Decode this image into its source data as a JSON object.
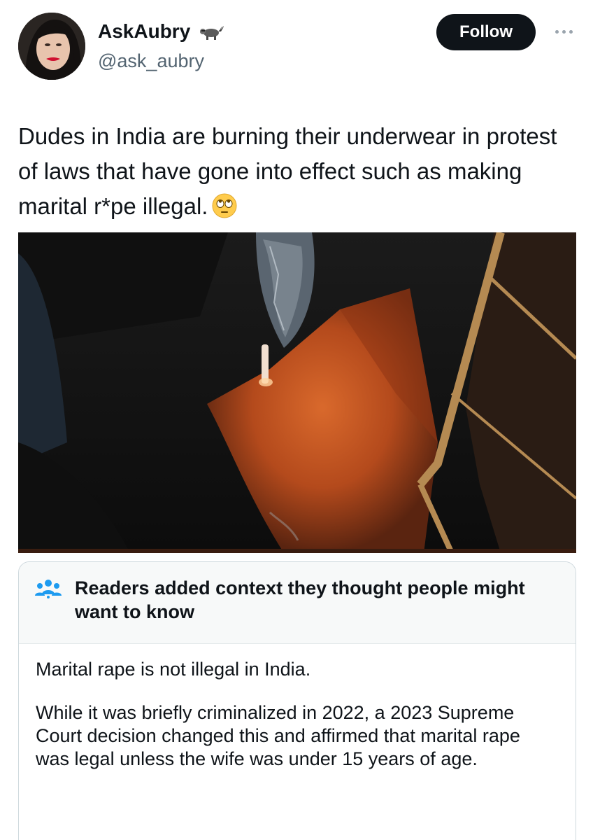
{
  "user": {
    "display_name": "AskAubry",
    "handle": "@ask_aubry",
    "badge_icon": "raccoon-icon",
    "avatar_icon": "avatar-photo"
  },
  "actions": {
    "follow_label": "Follow",
    "more_icon": "more-dots-icon"
  },
  "tweet": {
    "text": "Dudes in India are burning their underwear in protest of laws that have gone into effect such as making marital r*pe illegal.",
    "emoji_icon": "face-with-rolling-eyes-emoji"
  },
  "media": {
    "kind": "video-still",
    "icon": "burning-underwear-photo"
  },
  "community_note": {
    "header_icon": "people-icon",
    "title": "Readers added context they thought people might want to know",
    "paragraphs": [
      "Marital rape is not illegal in India.",
      "While it was briefly criminalized in 2022, a 2023 Supreme Court decision changed this and affirmed that marital rape was legal unless the wife was under 15 years of age."
    ]
  },
  "colors": {
    "text": "#0f1419",
    "secondary": "#536471",
    "follow_bg": "#0f1419",
    "follow_text": "#ffffff",
    "note_header_bg": "#f7f9f9",
    "note_icon": "#1d9bf0",
    "border": "#cfd9de"
  }
}
